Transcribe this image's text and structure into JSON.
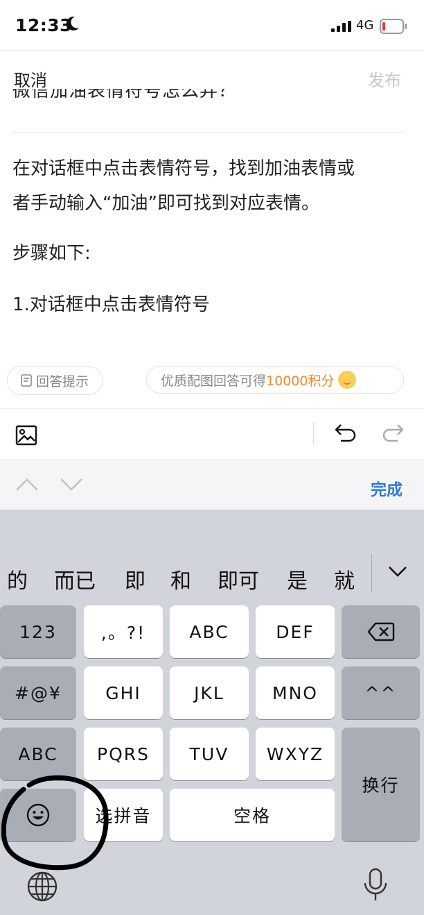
{
  "status_bar": {
    "time": "12:33",
    "network": "4G",
    "icons": [
      "moon-icon",
      "signal-icon",
      "battery-icon"
    ]
  },
  "nav": {
    "cancel_label": "取消",
    "publish_label": "发布"
  },
  "question_title_partial": "微信加油表情符号怎么弄？",
  "answer": {
    "paragraph1_line1": "在对话框中点击表情符号，找到加油表情或",
    "paragraph1_line2": "者手动输入“加油”即可找到对应表情。",
    "paragraph2": "步骤如下:",
    "paragraph3": "1.对话框中点击表情符号"
  },
  "hints": {
    "answer_tips_label": "回答提示",
    "reward_prefix": "优质配图回答可得",
    "reward_amount": "10000积分"
  },
  "toolbar": {
    "icons": [
      "image-icon",
      "undo-icon",
      "redo-icon"
    ]
  },
  "accessory": {
    "done_label": "完成",
    "icons": [
      "chevron-up-icon",
      "chevron-down-icon"
    ]
  },
  "keyboard": {
    "candidates": [
      "的",
      "而已",
      "即",
      "和",
      "即可",
      "是",
      "就"
    ],
    "keys": {
      "k123": "123",
      "punct": ",。?!",
      "abc": "ABC",
      "def": "DEF",
      "symbols": "#@¥",
      "ghi": "GHI",
      "jkl": "JKL",
      "mno": "MNO",
      "emoticon": "^^",
      "abc_mode": "ABC",
      "pqrs": "PQRS",
      "tuv": "TUV",
      "wxyz": "WXYZ",
      "return_label": "换行",
      "pinyin_label": "选拼音",
      "space_label": "空格"
    }
  },
  "colors": {
    "accent_blue": "#2f78e0",
    "reward_orange": "#f08a24",
    "keyboard_bg": "#d1d4da"
  }
}
